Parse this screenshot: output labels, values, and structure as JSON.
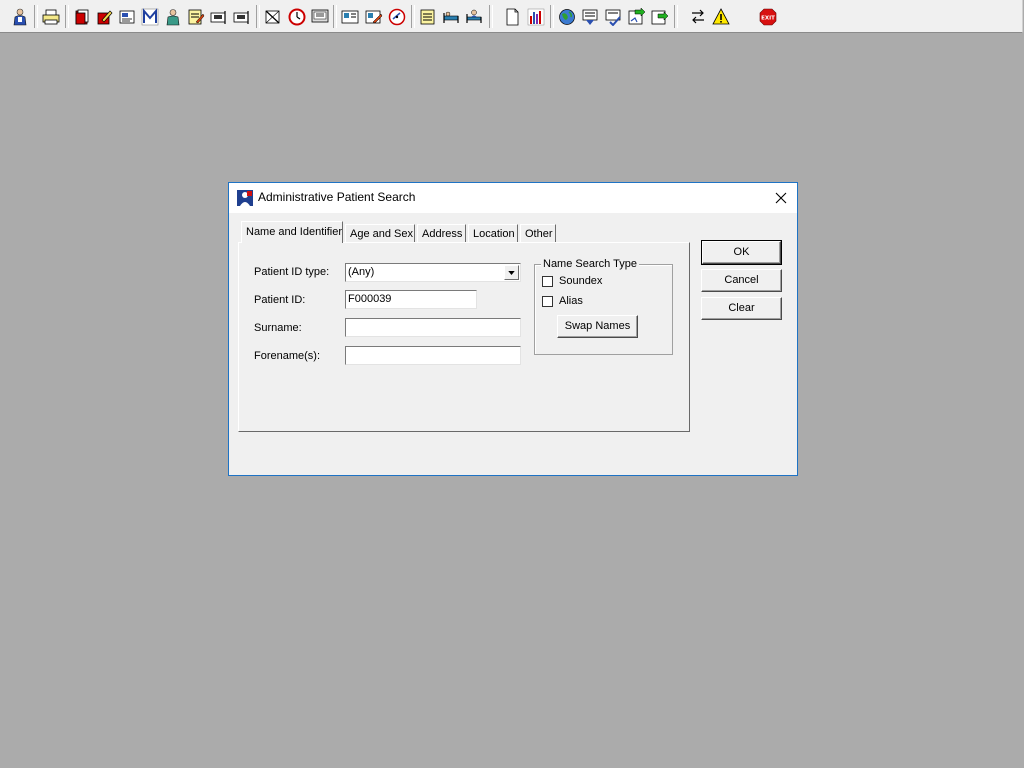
{
  "toolbar": {
    "buttons": [
      {
        "icon": "patient-icon"
      },
      {
        "icon": "printer-icon"
      },
      {
        "icon": "red-book-icon"
      },
      {
        "icon": "book-edit-icon"
      },
      {
        "icon": "report-icon"
      },
      {
        "icon": "monogram-m-icon"
      },
      {
        "icon": "clinician-icon"
      },
      {
        "icon": "notepad-edit-icon"
      },
      {
        "icon": "flag-icon"
      },
      {
        "icon": "flag-2-icon"
      },
      {
        "icon": "cancelled-document-icon"
      },
      {
        "icon": "clock-icon"
      },
      {
        "icon": "monitor-icon"
      },
      {
        "icon": "card-icon"
      },
      {
        "icon": "card-edit-icon"
      },
      {
        "icon": "clock-document-icon"
      },
      {
        "icon": "notes-icon"
      },
      {
        "icon": "bed-icon"
      },
      {
        "icon": "bed-person-icon"
      },
      {
        "icon": "page-icon"
      },
      {
        "icon": "bar-chart-icon"
      },
      {
        "icon": "globe-icon"
      },
      {
        "icon": "download-list-icon"
      },
      {
        "icon": "checklist-icon"
      },
      {
        "icon": "green-arrow-doc-icon"
      },
      {
        "icon": "green-arrow-doc-2-icon"
      },
      {
        "icon": "transfer-arrows-icon"
      },
      {
        "icon": "warning-icon"
      },
      {
        "icon": "exit-icon",
        "label": "EXIT"
      }
    ]
  },
  "dialog": {
    "title": "Administrative Patient Search",
    "tabs": [
      {
        "label": "Name and Identifier",
        "active": true
      },
      {
        "label": "Age and Sex",
        "active": false
      },
      {
        "label": "Address",
        "active": false
      },
      {
        "label": "Location",
        "active": false
      },
      {
        "label": "Other",
        "active": false
      }
    ],
    "fields": {
      "patient_id_type_label": "Patient ID type:",
      "patient_id_type_value": "(Any)",
      "patient_id_label": "Patient ID:",
      "patient_id_value": "F000039",
      "surname_label": "Surname:",
      "surname_value": "",
      "forename_label": "Forename(s):",
      "forename_value": ""
    },
    "name_search_type": {
      "title": "Name Search Type",
      "soundex_label": "Soundex",
      "soundex_checked": false,
      "alias_label": "Alias",
      "alias_checked": false,
      "swap_names_label": "Swap Names"
    },
    "buttons": {
      "ok": "OK",
      "cancel": "Cancel",
      "clear": "Clear"
    }
  },
  "colors": {
    "desktop": "#ababab",
    "dialog_border": "#1e73c5",
    "window_face": "#f0f0f0"
  }
}
